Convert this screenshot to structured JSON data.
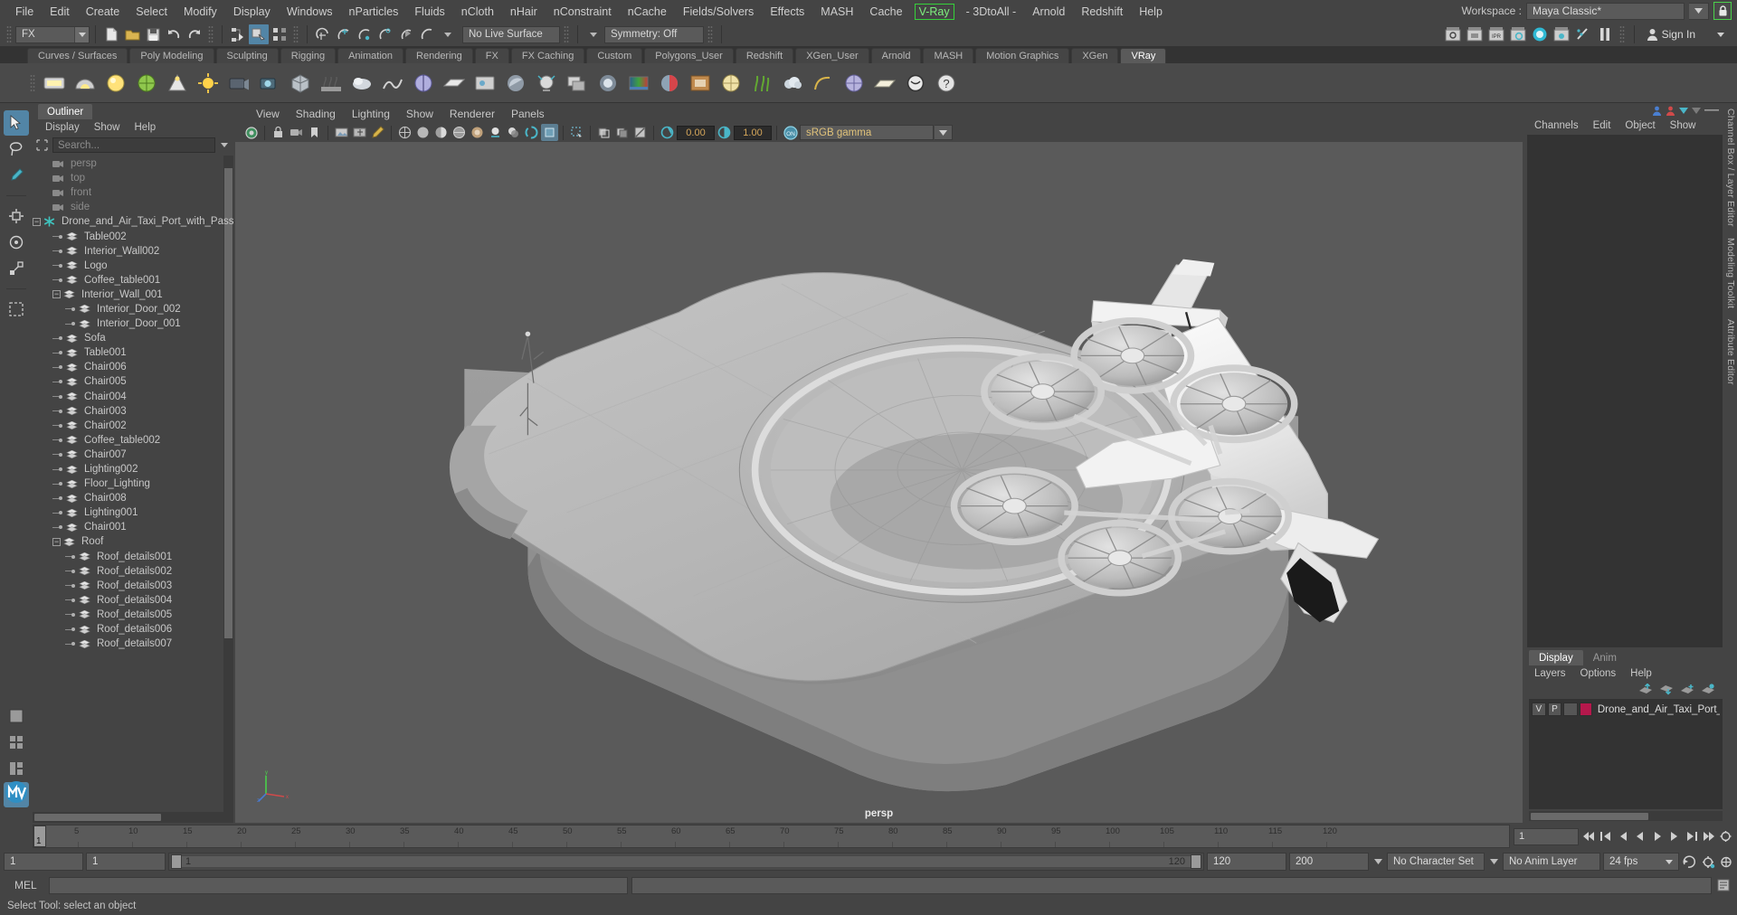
{
  "menu": {
    "items": [
      "File",
      "Edit",
      "Create",
      "Select",
      "Modify",
      "Display",
      "Windows",
      "nParticles",
      "Fluids",
      "nCloth",
      "nHair",
      "nConstraint",
      "nCache",
      "Fields/Solvers",
      "Effects",
      "MASH",
      "Cache",
      "V-Ray",
      "- 3DtoAll -",
      "Arnold",
      "Redshift",
      "Help"
    ],
    "highlighted": "V-Ray",
    "workspace_label": "Workspace :",
    "workspace_value": "Maya Classic*"
  },
  "statusline": {
    "menuset": "FX",
    "live_surface": "No Live Surface",
    "symmetry": "Symmetry: Off",
    "signin": "Sign In"
  },
  "shelf": {
    "tabs": [
      "Curves / Surfaces",
      "Poly Modeling",
      "Sculpting",
      "Rigging",
      "Animation",
      "Rendering",
      "FX",
      "FX Caching",
      "Custom",
      "Polygons_User",
      "Redshift",
      "XGen_User",
      "Arnold",
      "MASH",
      "Motion Graphics",
      "XGen",
      "VRay"
    ],
    "selected": "VRay"
  },
  "outliner": {
    "tab": "Outliner",
    "menu": [
      "Display",
      "Show",
      "Help"
    ],
    "search_placeholder": "Search...",
    "items": [
      {
        "label": "persp",
        "type": "camera",
        "depth": 1
      },
      {
        "label": "top",
        "type": "camera",
        "depth": 1
      },
      {
        "label": "front",
        "type": "camera",
        "depth": 1
      },
      {
        "label": "side",
        "type": "camera",
        "depth": 1
      },
      {
        "label": "Drone_and_Air_Taxi_Port_with_Passen",
        "type": "group",
        "depth": 0,
        "expanded": true
      },
      {
        "label": "Table002",
        "type": "mesh",
        "depth": 1
      },
      {
        "label": "Interior_Wall002",
        "type": "mesh",
        "depth": 1
      },
      {
        "label": "Logo",
        "type": "mesh",
        "depth": 1
      },
      {
        "label": "Coffee_table001",
        "type": "mesh",
        "depth": 1
      },
      {
        "label": "Interior_Wall_001",
        "type": "mesh",
        "depth": 1,
        "expanded": true
      },
      {
        "label": "Interior_Door_002",
        "type": "mesh",
        "depth": 2
      },
      {
        "label": "Interior_Door_001",
        "type": "mesh",
        "depth": 2
      },
      {
        "label": "Sofa",
        "type": "mesh",
        "depth": 1
      },
      {
        "label": "Table001",
        "type": "mesh",
        "depth": 1
      },
      {
        "label": "Chair006",
        "type": "mesh",
        "depth": 1
      },
      {
        "label": "Chair005",
        "type": "mesh",
        "depth": 1
      },
      {
        "label": "Chair004",
        "type": "mesh",
        "depth": 1
      },
      {
        "label": "Chair003",
        "type": "mesh",
        "depth": 1
      },
      {
        "label": "Chair002",
        "type": "mesh",
        "depth": 1
      },
      {
        "label": "Coffee_table002",
        "type": "mesh",
        "depth": 1
      },
      {
        "label": "Chair007",
        "type": "mesh",
        "depth": 1
      },
      {
        "label": "Lighting002",
        "type": "mesh",
        "depth": 1
      },
      {
        "label": "Floor_Lighting",
        "type": "mesh",
        "depth": 1
      },
      {
        "label": "Chair008",
        "type": "mesh",
        "depth": 1
      },
      {
        "label": "Lighting001",
        "type": "mesh",
        "depth": 1
      },
      {
        "label": "Chair001",
        "type": "mesh",
        "depth": 1
      },
      {
        "label": "Roof",
        "type": "mesh",
        "depth": 1,
        "expanded": true
      },
      {
        "label": "Roof_details001",
        "type": "mesh",
        "depth": 2
      },
      {
        "label": "Roof_details002",
        "type": "mesh",
        "depth": 2
      },
      {
        "label": "Roof_details003",
        "type": "mesh",
        "depth": 2
      },
      {
        "label": "Roof_details004",
        "type": "mesh",
        "depth": 2
      },
      {
        "label": "Roof_details005",
        "type": "mesh",
        "depth": 2
      },
      {
        "label": "Roof_details006",
        "type": "mesh",
        "depth": 2
      },
      {
        "label": "Roof_details007",
        "type": "mesh",
        "depth": 2
      }
    ]
  },
  "viewport": {
    "menu": [
      "View",
      "Shading",
      "Lighting",
      "Show",
      "Renderer",
      "Panels"
    ],
    "exposure": "0.00",
    "gamma": "1.00",
    "colorspace": "sRGB gamma",
    "camera_label": "persp"
  },
  "channelbox": {
    "menu": [
      "Channels",
      "Edit",
      "Object",
      "Show"
    ],
    "vtabs": [
      "Channel Box / Layer Editor",
      "Modeling Toolkit",
      "Attribute Editor"
    ]
  },
  "layereditor": {
    "tabs": [
      "Display",
      "Anim"
    ],
    "selected_tab": "Display",
    "menu": [
      "Layers",
      "Options",
      "Help"
    ],
    "layers": [
      {
        "visibility": "V",
        "playback": "P",
        "type": "",
        "color": "#b5184c",
        "name": "Drone_and_Air_Taxi_Port_with"
      }
    ]
  },
  "timeline": {
    "ticks": [
      "5",
      "10",
      "15",
      "20",
      "25",
      "30",
      "35",
      "40",
      "45",
      "50",
      "55",
      "60",
      "65",
      "70",
      "75",
      "80",
      "85",
      "90",
      "95",
      "100",
      "105",
      "110",
      "115",
      "120"
    ],
    "current_frame": "1",
    "current_frame_field": "1"
  },
  "rangeslider": {
    "start": "1",
    "anim_start": "1",
    "range_start": "1",
    "range_end": "120",
    "anim_end": "120",
    "end": "200",
    "character_set": "No Character Set",
    "anim_layer": "No Anim Layer",
    "fps": "24 fps"
  },
  "command": {
    "label": "MEL",
    "input_value": "",
    "output_value": ""
  },
  "helpline": {
    "text": "Select Tool: select an object"
  },
  "colors": {
    "accent_blue": "#5285a6",
    "teal": "#4ab6c8",
    "vray_green": "#36d13a",
    "layer_red": "#b5184c",
    "panel_bg": "#444444",
    "dark_bg": "#333333",
    "viewport_bg": "#5a5a5a"
  }
}
